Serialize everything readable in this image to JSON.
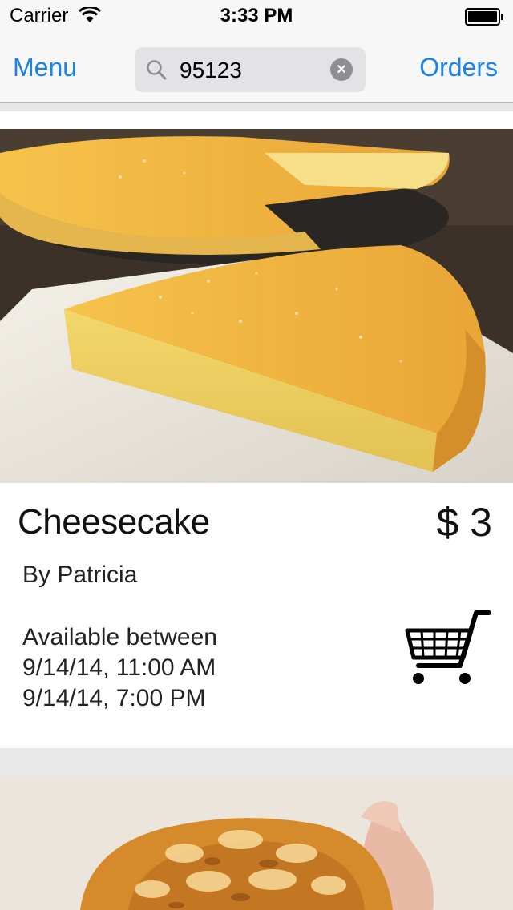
{
  "status_bar": {
    "carrier": "Carrier",
    "time": "3:33 PM",
    "wifi_icon": "wifi-icon",
    "battery_icon": "battery-full-icon"
  },
  "nav": {
    "menu_label": "Menu",
    "orders_label": "Orders",
    "search": {
      "value": "95123",
      "search_icon": "search-icon",
      "clear_icon": "clear-icon"
    }
  },
  "listings": [
    {
      "title": "Cheesecake",
      "price": "$ 3",
      "author": "By Patricia",
      "availability_label": "Available between",
      "available_start": "9/14/14, 11:00 AM",
      "available_end": "9/14/14, 7:00 PM",
      "image": "cheesecake-photo",
      "action_icon": "shopping-cart-icon"
    },
    {
      "image": "pastry-bun-photo"
    }
  ],
  "colors": {
    "accent": "#1a82e8",
    "nav_background": "#f7f7f7",
    "search_field": "#e3e3e5",
    "separator": "#e8e8e8"
  }
}
